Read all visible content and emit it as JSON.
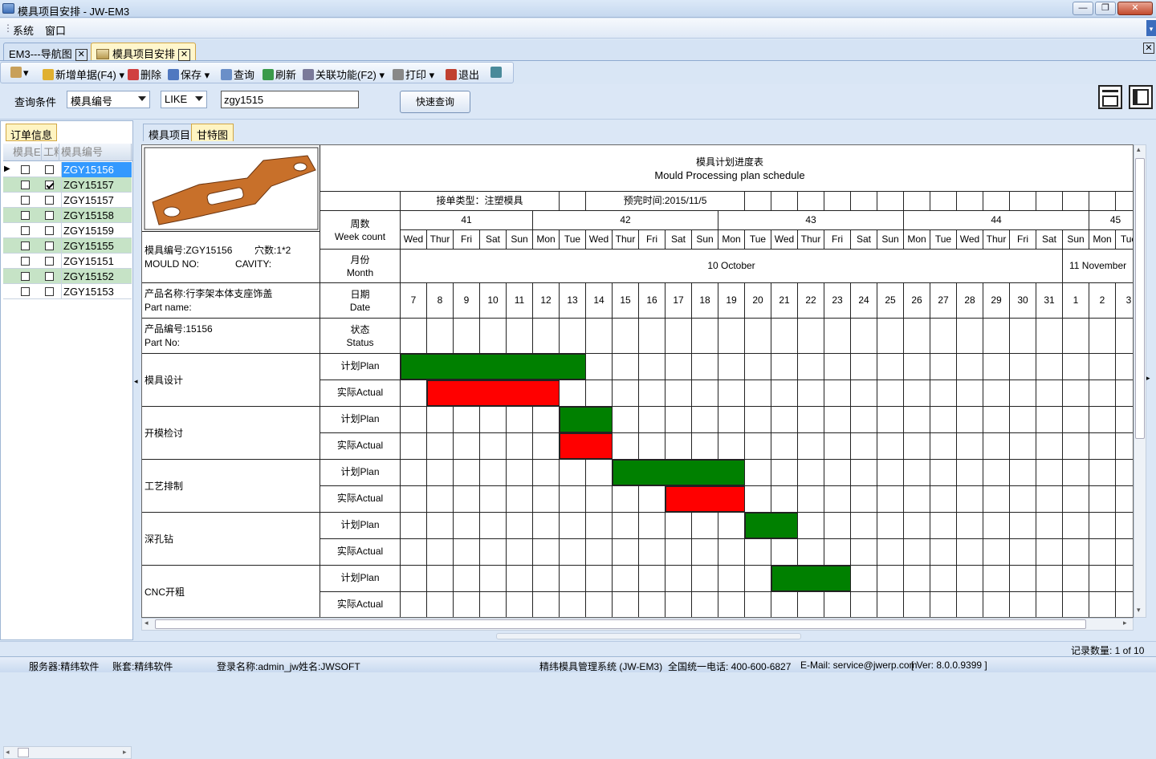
{
  "window": {
    "title": "模具项目安排 - JW-EM3",
    "minimize": "—",
    "restore": "❐",
    "close": "✕"
  },
  "menu": {
    "items": [
      "系统",
      "窗口"
    ]
  },
  "doc_tabs": [
    {
      "label": "EM3---导航图",
      "close": "✕"
    },
    {
      "label": "模具项目安排",
      "close": "✕"
    }
  ],
  "toolbar": {
    "new_label": "新增单据(F4)",
    "delete_label": "删除",
    "save_label": "保存",
    "query_label": "查询",
    "refresh_label": "刷新",
    "related_label": "关联功能(F2)",
    "print_label": "打印",
    "exit_label": "退出"
  },
  "query": {
    "label": "查询条件",
    "field": "模具编号",
    "operator": "LIKE",
    "value": "zgy1515",
    "button": "快速查询"
  },
  "left": {
    "tab": "订单信息",
    "headers": [
      "模具E",
      "工料",
      "模具编号"
    ],
    "rows": [
      {
        "code": "ZGY15156",
        "c1": false,
        "c2": false,
        "selected": true
      },
      {
        "code": "ZGY15157",
        "c1": false,
        "c2": true,
        "green": true
      },
      {
        "code": "ZGY15157",
        "c1": false,
        "c2": false
      },
      {
        "code": "ZGY15158",
        "c1": false,
        "c2": false,
        "green": true
      },
      {
        "code": "ZGY15159",
        "c1": false,
        "c2": false
      },
      {
        "code": "ZGY15155",
        "c1": false,
        "c2": false,
        "green": true
      },
      {
        "code": "ZGY15151",
        "c1": false,
        "c2": false
      },
      {
        "code": "ZGY15152",
        "c1": false,
        "c2": false,
        "green": true
      },
      {
        "code": "ZGY15153",
        "c1": false,
        "c2": false
      }
    ]
  },
  "right_tabs": [
    "模具项目",
    "甘特图"
  ],
  "gantt": {
    "title_cn": "模具计划进度表",
    "title_en": "Mould Processing plan schedule",
    "order_type": "接单类型：注塑模具",
    "due_date": "预完时间:2015/11/5",
    "mould_no": "模具编号:ZGY15156",
    "cavity": "穴数:1*2",
    "mould_no_en": "MOULD NO:",
    "cavity_en": "CAVITY:",
    "part_name": "产品名称:行李架本体支座饰盖",
    "part_name_en": "Part name:",
    "part_no": "产品编号:15156",
    "part_no_en": "Part No:",
    "row_labels": {
      "week": "周数\nWeek count",
      "month": "月份\nMonth",
      "date": "日期\nDate",
      "status": "状态\nStatus"
    },
    "weeks": [
      "41",
      "42",
      "43",
      "44",
      "45"
    ],
    "days": [
      "Wed",
      "Thur",
      "Fri",
      "Sat",
      "Sun",
      "Mon",
      "Tue",
      "Wed",
      "Thur",
      "Fri",
      "Sat",
      "Sun",
      "Mon",
      "Tue",
      "Wed",
      "Thur",
      "Fri",
      "Sat",
      "Sun",
      "Mon",
      "Tue",
      "Wed",
      "Thur",
      "Fri",
      "Sat",
      "Sun",
      "Mon",
      "Tue"
    ],
    "months": [
      "10 October",
      "11 November"
    ],
    "dates": [
      "7",
      "8",
      "9",
      "10",
      "11",
      "12",
      "13",
      "14",
      "15",
      "16",
      "17",
      "18",
      "19",
      "20",
      "21",
      "22",
      "23",
      "24",
      "25",
      "26",
      "27",
      "28",
      "29",
      "30",
      "31",
      "1",
      "2",
      "3"
    ],
    "plan_label": "计划Plan",
    "actual_label": "实际Actual",
    "tasks": [
      {
        "name": "模具设计",
        "plan": [
          0,
          7
        ],
        "actual": [
          1,
          6
        ]
      },
      {
        "name": "开模检讨",
        "plan": [
          6,
          8
        ],
        "actual": [
          6,
          8
        ]
      },
      {
        "name": "工艺排制",
        "plan": [
          8,
          13
        ],
        "actual": [
          10,
          13
        ]
      },
      {
        "name": "深孔钻",
        "plan": [
          13,
          15
        ],
        "actual": null
      },
      {
        "name": "CNC开粗",
        "plan": [
          14,
          17
        ],
        "actual": null
      }
    ],
    "colors": {
      "plan": "#008000",
      "actual": "#ff0000"
    }
  },
  "status": {
    "records": "记录数量: 1 of 10",
    "server": "服务器:精纬软件",
    "account": "账套:精纬软件",
    "login": "登录名称:admin_jw",
    "user": "姓名:JWSOFT",
    "system": "精纬模具管理系统 (JW-EM3)",
    "phone": "全国统一电话: 400-600-6827",
    "email": "E-Mail: service@jwerp.com",
    "version": "[ Ver: 8.0.0.9399 ]"
  }
}
